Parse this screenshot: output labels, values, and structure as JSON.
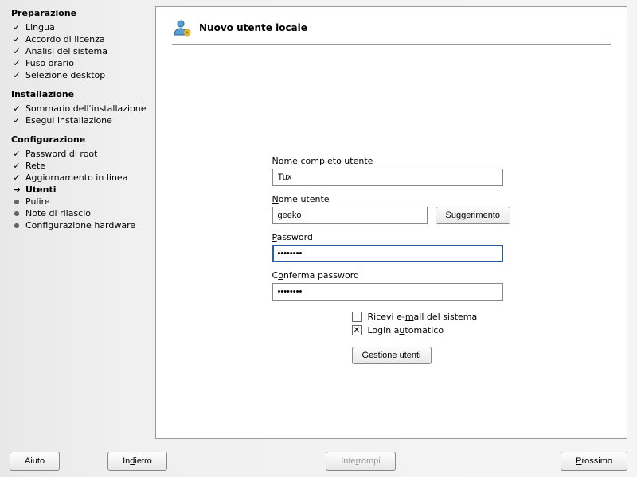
{
  "sidebar": {
    "sections": [
      {
        "title": "Preparazione",
        "items": [
          {
            "label": "Lingua",
            "state": "done"
          },
          {
            "label": "Accordo di licenza",
            "state": "done"
          },
          {
            "label": "Analisi del sistema",
            "state": "done"
          },
          {
            "label": "Fuso orario",
            "state": "done"
          },
          {
            "label": "Selezione desktop",
            "state": "done"
          }
        ]
      },
      {
        "title": "Installazione",
        "items": [
          {
            "label": "Sommario dell'installazione",
            "state": "done"
          },
          {
            "label": "Esegui installazione",
            "state": "done"
          }
        ]
      },
      {
        "title": "Configurazione",
        "items": [
          {
            "label": "Password di root",
            "state": "done"
          },
          {
            "label": "Rete",
            "state": "done"
          },
          {
            "label": "Aggiornamento in linea",
            "state": "done"
          },
          {
            "label": "Utenti",
            "state": "current"
          },
          {
            "label": "Pulire",
            "state": "pending"
          },
          {
            "label": "Note di rilascio",
            "state": "pending"
          },
          {
            "label": "Configurazione hardware",
            "state": "pending"
          }
        ]
      }
    ]
  },
  "panel": {
    "title": "Nuovo utente locale"
  },
  "form": {
    "fullname_label_pre": "Nome ",
    "fullname_label_u": "c",
    "fullname_label_post": "ompleto utente",
    "fullname_value": "Tux",
    "username_label_u": "N",
    "username_label_post": "ome utente",
    "username_value": "geeko",
    "suggest_btn_u": "S",
    "suggest_btn_post": "uggerimento",
    "password_label_u": "P",
    "password_label_post": "assword",
    "password_value": "********",
    "confirm_label_pre": "C",
    "confirm_label_u": "o",
    "confirm_label_post": "nferma password",
    "confirm_value": "********",
    "receive_mail_pre": "Ricevi e-",
    "receive_mail_u": "m",
    "receive_mail_post": "ail del sistema",
    "receive_mail_checked": false,
    "auto_login_pre": "Login a",
    "auto_login_u": "u",
    "auto_login_post": "tomatico",
    "auto_login_checked": true,
    "user_mgmt_u": "G",
    "user_mgmt_post": "estione utenti"
  },
  "buttons": {
    "help": "Aiuto",
    "back_pre": "In",
    "back_u": "d",
    "back_post": "ietro",
    "abort_pre": "Inte",
    "abort_u": "r",
    "abort_post": "rompi",
    "next_u": "P",
    "next_post": "rossimo"
  }
}
